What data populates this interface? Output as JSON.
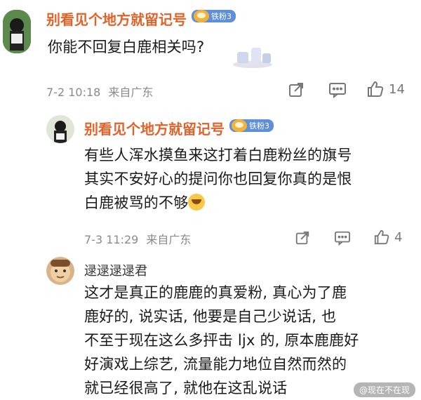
{
  "comments": [
    {
      "username": "别看见个地方就留记号",
      "badge": "铁粉3",
      "text": "你能不回复白鹿相关吗?",
      "time": "7-2 10:18",
      "location": "来自广东",
      "likes": "14"
    },
    {
      "username": "别看见个地方就留记号",
      "badge": "铁粉3",
      "lines": [
        "有些人浑水摸鱼来这打着白鹿粉丝的旗号",
        "其实不安好心的提问你也回复你真的是恨",
        "白鹿被骂的不够"
      ],
      "time": "7-3 11:29",
      "location": "来自广东",
      "likes": "4"
    },
    {
      "username": "逯逯逯逯君",
      "lines": [
        "这才是真正的鹿鹿的真爱粉, 真心为了鹿",
        "鹿好的, 说实话, 他要是自己少说话, 也",
        "不至于现在这么多抨击 ljx 的, 原本鹿鹿好",
        "好演戏上综艺, 流量能力地位自然而然的",
        "就已经很高了, 就他在这乱说话"
      ]
    }
  ],
  "watermark": "@现在不在现",
  "colors": {
    "username": "#e0632a",
    "badge": "#5f8fd8"
  }
}
